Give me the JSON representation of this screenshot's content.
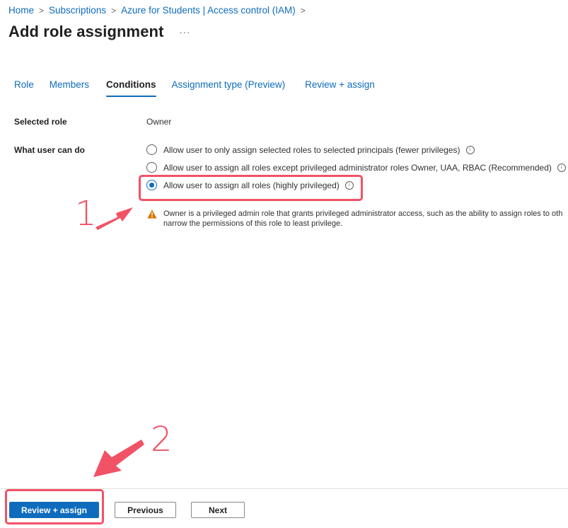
{
  "breadcrumb": {
    "items": [
      "Home",
      "Subscriptions",
      "Azure for Students | Access control (IAM)"
    ],
    "separator": ">"
  },
  "header": {
    "title": "Add role assignment",
    "more_label": "···"
  },
  "tabs": [
    {
      "label": "Role",
      "active": false
    },
    {
      "label": "Members",
      "active": false
    },
    {
      "label": "Conditions",
      "active": true
    },
    {
      "label": "Assignment type (Preview)",
      "active": false
    },
    {
      "label": "Review + assign",
      "active": false
    }
  ],
  "form": {
    "selected_role_label": "Selected role",
    "selected_role_value": "Owner",
    "what_user_can_do_label": "What user can do",
    "options": [
      {
        "label": "Allow user to only assign selected roles to selected principals (fewer privileges)",
        "checked": false
      },
      {
        "label": "Allow user to assign all roles except privileged administrator roles Owner, UAA, RBAC (Recommended)",
        "checked": false
      },
      {
        "label": "Allow user to assign all roles (highly privileged)",
        "checked": true
      }
    ],
    "info_glyph": "i",
    "warning_line1": "Owner is a privileged admin role that grants privileged administrator access, such as the ability to assign roles to oth",
    "warning_line2": "narrow the permissions of this role to least privilege."
  },
  "annotations": {
    "step1": "1",
    "step2": "2",
    "color": "#f25266"
  },
  "footer": {
    "review_assign_label": "Review + assign",
    "previous_label": "Previous",
    "next_label": "Next"
  },
  "colors": {
    "accent": "#0f6cbd",
    "warning": "#d47500"
  }
}
